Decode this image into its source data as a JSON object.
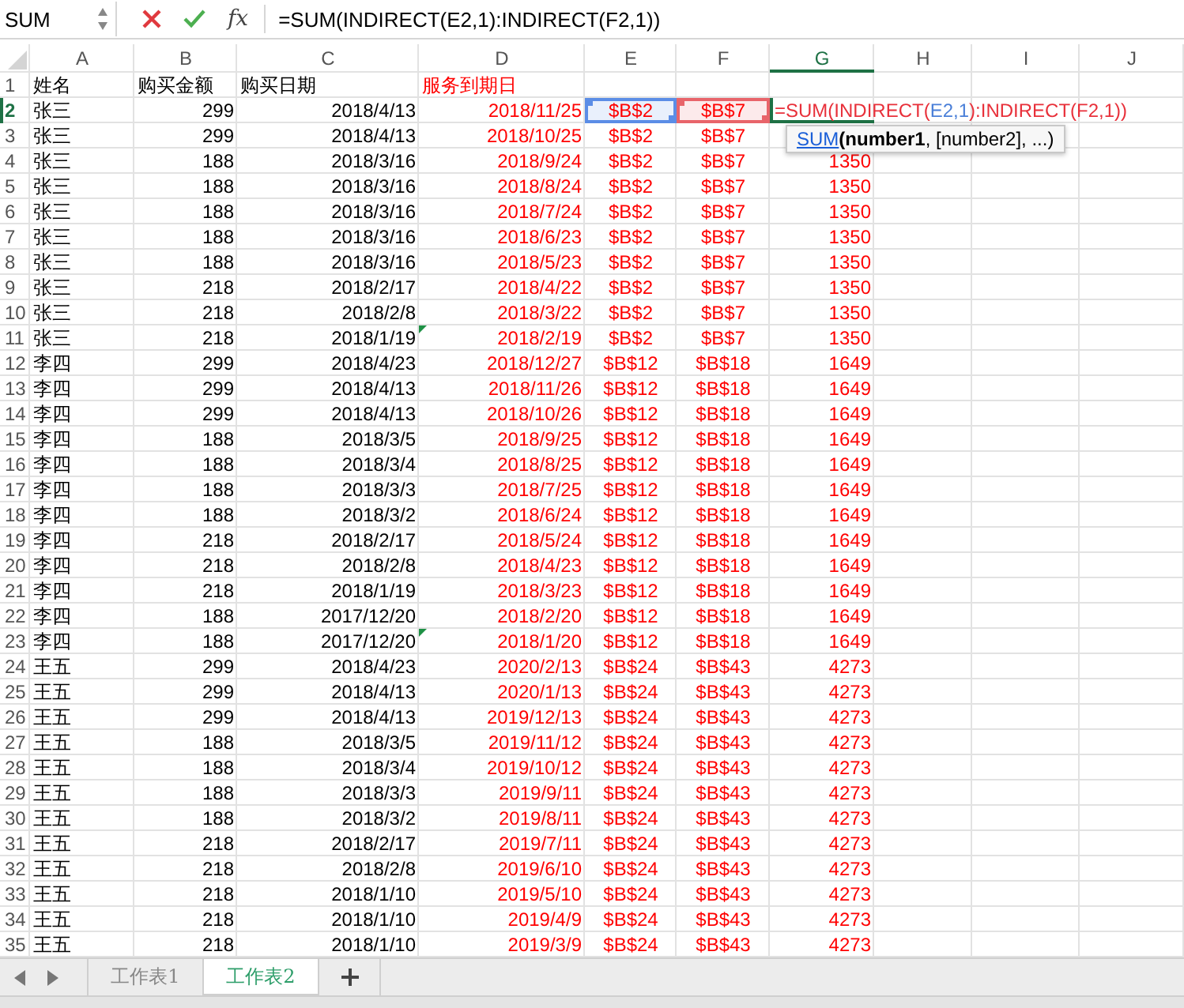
{
  "formula_bar": {
    "name_box": "SUM",
    "function_label": "fx",
    "formula": "=SUM(INDIRECT(E2,1):INDIRECT(F2,1))"
  },
  "columns": [
    {
      "label": "A",
      "selected": false,
      "color": "#000000"
    },
    {
      "label": "B",
      "selected": false,
      "color": "#000000"
    },
    {
      "label": "C",
      "selected": false,
      "color": "#000000"
    },
    {
      "label": "D",
      "selected": false,
      "color": "#ff0000"
    },
    {
      "label": "E",
      "selected": false,
      "color": "#ff0000"
    },
    {
      "label": "F",
      "selected": false,
      "color": "#ff0000"
    },
    {
      "label": "G",
      "selected": true,
      "color": "#ff0000"
    },
    {
      "label": "H",
      "selected": false
    },
    {
      "label": "I",
      "selected": false
    },
    {
      "label": "J",
      "selected": false
    }
  ],
  "rows": [
    {
      "number": "1",
      "selected": false,
      "cells": [
        "姓名",
        "购买金额",
        "购买日期",
        "服务到期日"
      ]
    },
    {
      "number": "2",
      "selected": true,
      "cells": [
        "张三",
        "299",
        "2018/4/13",
        "2018/11/25",
        {
          "kind": "reference",
          "text": "$B$2",
          "color": "#5b8de6"
        },
        {
          "kind": "reference",
          "text": "$B$7",
          "color": "#e8646a"
        },
        {
          "kind": "formula",
          "segments": [
            {
              "text": "=SUM(INDIRECT(",
              "color": "#e8303a"
            },
            {
              "text": "E2,1",
              "color": "#4a7fd8"
            },
            {
              "text": "):INDIRECT(F2,1))",
              "color": "#e8303a"
            }
          ]
        }
      ]
    },
    {
      "number": "3",
      "selected": false,
      "cells": [
        "张三",
        "299",
        "2018/4/13",
        "2018/10/25",
        "$B$2",
        "$B$7"
      ]
    },
    {
      "number": "4",
      "selected": false,
      "cells": [
        "张三",
        "188",
        "2018/3/16",
        "2018/9/24",
        "$B$2",
        "$B$7",
        "1350"
      ]
    },
    {
      "number": "5",
      "selected": false,
      "cells": [
        "张三",
        "188",
        "2018/3/16",
        "2018/8/24",
        "$B$2",
        "$B$7",
        "1350"
      ]
    },
    {
      "number": "6",
      "selected": false,
      "cells": [
        "张三",
        "188",
        "2018/3/16",
        "2018/7/24",
        "$B$2",
        "$B$7",
        "1350"
      ]
    },
    {
      "number": "7",
      "selected": false,
      "cells": [
        "张三",
        "188",
        "2018/3/16",
        "2018/6/23",
        "$B$2",
        "$B$7",
        "1350"
      ]
    },
    {
      "number": "8",
      "selected": false,
      "cells": [
        "张三",
        "188",
        "2018/3/16",
        "2018/5/23",
        "$B$2",
        "$B$7",
        "1350"
      ]
    },
    {
      "number": "9",
      "selected": false,
      "cells": [
        "张三",
        "218",
        "2018/2/17",
        "2018/4/22",
        "$B$2",
        "$B$7",
        "1350"
      ]
    },
    {
      "number": "10",
      "selected": false,
      "cells": [
        "张三",
        "218",
        "2018/2/8",
        "2018/3/22",
        "$B$2",
        "$B$7",
        "1350"
      ]
    },
    {
      "number": "11",
      "selected": false,
      "cells": [
        "张三",
        "218",
        "2018/1/19",
        {
          "kind": "flagged",
          "text": "2018/2/19"
        },
        "$B$2",
        "$B$7",
        "1350"
      ]
    },
    {
      "number": "12",
      "selected": false,
      "cells": [
        "李四",
        "299",
        "2018/4/23",
        "2018/12/27",
        "$B$12",
        "$B$18",
        "1649"
      ]
    },
    {
      "number": "13",
      "selected": false,
      "cells": [
        "李四",
        "299",
        "2018/4/13",
        "2018/11/26",
        "$B$12",
        "$B$18",
        "1649"
      ]
    },
    {
      "number": "14",
      "selected": false,
      "cells": [
        "李四",
        "299",
        "2018/4/13",
        "2018/10/26",
        "$B$12",
        "$B$18",
        "1649"
      ]
    },
    {
      "number": "15",
      "selected": false,
      "cells": [
        "李四",
        "188",
        "2018/3/5",
        "2018/9/25",
        "$B$12",
        "$B$18",
        "1649"
      ]
    },
    {
      "number": "16",
      "selected": false,
      "cells": [
        "李四",
        "188",
        "2018/3/4",
        "2018/8/25",
        "$B$12",
        "$B$18",
        "1649"
      ]
    },
    {
      "number": "17",
      "selected": false,
      "cells": [
        "李四",
        "188",
        "2018/3/3",
        "2018/7/25",
        "$B$12",
        "$B$18",
        "1649"
      ]
    },
    {
      "number": "18",
      "selected": false,
      "cells": [
        "李四",
        "188",
        "2018/3/2",
        "2018/6/24",
        "$B$12",
        "$B$18",
        "1649"
      ]
    },
    {
      "number": "19",
      "selected": false,
      "cells": [
        "李四",
        "218",
        "2018/2/17",
        "2018/5/24",
        "$B$12",
        "$B$18",
        "1649"
      ]
    },
    {
      "number": "20",
      "selected": false,
      "cells": [
        "李四",
        "218",
        "2018/2/8",
        "2018/4/23",
        "$B$12",
        "$B$18",
        "1649"
      ]
    },
    {
      "number": "21",
      "selected": false,
      "cells": [
        "李四",
        "218",
        "2018/1/19",
        "2018/3/23",
        "$B$12",
        "$B$18",
        "1649"
      ]
    },
    {
      "number": "22",
      "selected": false,
      "cells": [
        "李四",
        "188",
        "2017/12/20",
        "2018/2/20",
        "$B$12",
        "$B$18",
        "1649"
      ]
    },
    {
      "number": "23",
      "selected": false,
      "cells": [
        "李四",
        "188",
        "2017/12/20",
        {
          "kind": "flagged",
          "text": "2018/1/20"
        },
        "$B$12",
        "$B$18",
        "1649"
      ]
    },
    {
      "number": "24",
      "selected": false,
      "cells": [
        "王五",
        "299",
        "2018/4/23",
        "2020/2/13",
        "$B$24",
        "$B$43",
        "4273"
      ]
    },
    {
      "number": "25",
      "selected": false,
      "cells": [
        "王五",
        "299",
        "2018/4/13",
        "2020/1/13",
        "$B$24",
        "$B$43",
        "4273"
      ]
    },
    {
      "number": "26",
      "selected": false,
      "cells": [
        "王五",
        "299",
        "2018/4/13",
        "2019/12/13",
        "$B$24",
        "$B$43",
        "4273"
      ]
    },
    {
      "number": "27",
      "selected": false,
      "cells": [
        "王五",
        "188",
        "2018/3/5",
        "2019/11/12",
        "$B$24",
        "$B$43",
        "4273"
      ]
    },
    {
      "number": "28",
      "selected": false,
      "cells": [
        "王五",
        "188",
        "2018/3/4",
        "2019/10/12",
        "$B$24",
        "$B$43",
        "4273"
      ]
    },
    {
      "number": "29",
      "selected": false,
      "cells": [
        "王五",
        "188",
        "2018/3/3",
        "2019/9/11",
        "$B$24",
        "$B$43",
        "4273"
      ]
    },
    {
      "number": "30",
      "selected": false,
      "cells": [
        "王五",
        "188",
        "2018/3/2",
        "2019/8/11",
        "$B$24",
        "$B$43",
        "4273"
      ]
    },
    {
      "number": "31",
      "selected": false,
      "cells": [
        "王五",
        "218",
        "2018/2/17",
        "2019/7/11",
        "$B$24",
        "$B$43",
        "4273"
      ]
    },
    {
      "number": "32",
      "selected": false,
      "cells": [
        "王五",
        "218",
        "2018/2/8",
        "2019/6/10",
        "$B$24",
        "$B$43",
        "4273"
      ]
    },
    {
      "number": "33",
      "selected": false,
      "cells": [
        "王五",
        "218",
        "2018/1/10",
        "2019/5/10",
        "$B$24",
        "$B$43",
        "4273"
      ]
    },
    {
      "number": "34",
      "selected": false,
      "cells": [
        "王五",
        "218",
        "2018/1/10",
        "2019/4/9",
        "$B$24",
        "$B$43",
        "4273"
      ]
    },
    {
      "number": "35",
      "selected": false,
      "cells": [
        "王五",
        "218",
        "2018/1/10",
        "2019/3/9",
        "$B$24",
        "$B$43",
        "4273"
      ]
    }
  ],
  "tooltip": {
    "function": "SUM",
    "arguments": "**(number1**, [number2], ...)"
  },
  "sheet_tabs": [
    {
      "label": "工作表1",
      "selected": false
    },
    {
      "label": "工作表2",
      "selected": true
    }
  ]
}
